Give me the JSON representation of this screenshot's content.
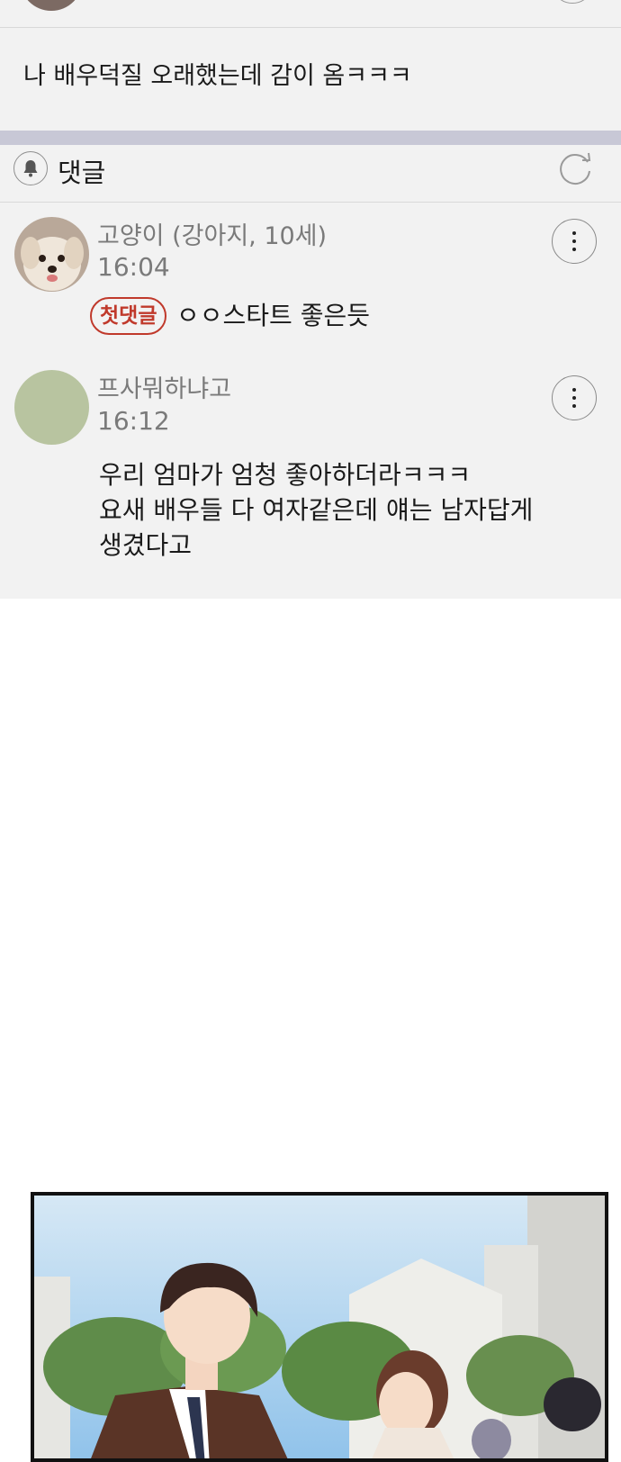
{
  "post": {
    "text": "나 배우덕질 오래했는데 감이 옴ㅋㅋㅋ"
  },
  "comments_section": {
    "label": "댓글",
    "icons": {
      "bell": "bell-icon",
      "refresh": "refresh-icon"
    }
  },
  "comments": [
    {
      "author": "고양이 (강아지, 10세)",
      "time": "16:04",
      "badge": "첫댓글",
      "text_lines": [
        "ㅇㅇ스타트 좋은듯"
      ],
      "avatar": "dog-photo"
    },
    {
      "author": "프사뭐하냐고",
      "time": "16:12",
      "text_lines": [
        "우리 엄마가 엄청 좋아하더라ㅋㅋㅋ",
        "요새 배우들 다 여자같은데  얘는 남자답게",
        "생겼다고"
      ],
      "avatar_color": "#b8c4a0"
    }
  ],
  "colors": {
    "card_bg": "#f2f2f2",
    "band": "#c8c8d6",
    "badge_red": "#c0392b",
    "meta_gray": "#7a7a7a"
  }
}
